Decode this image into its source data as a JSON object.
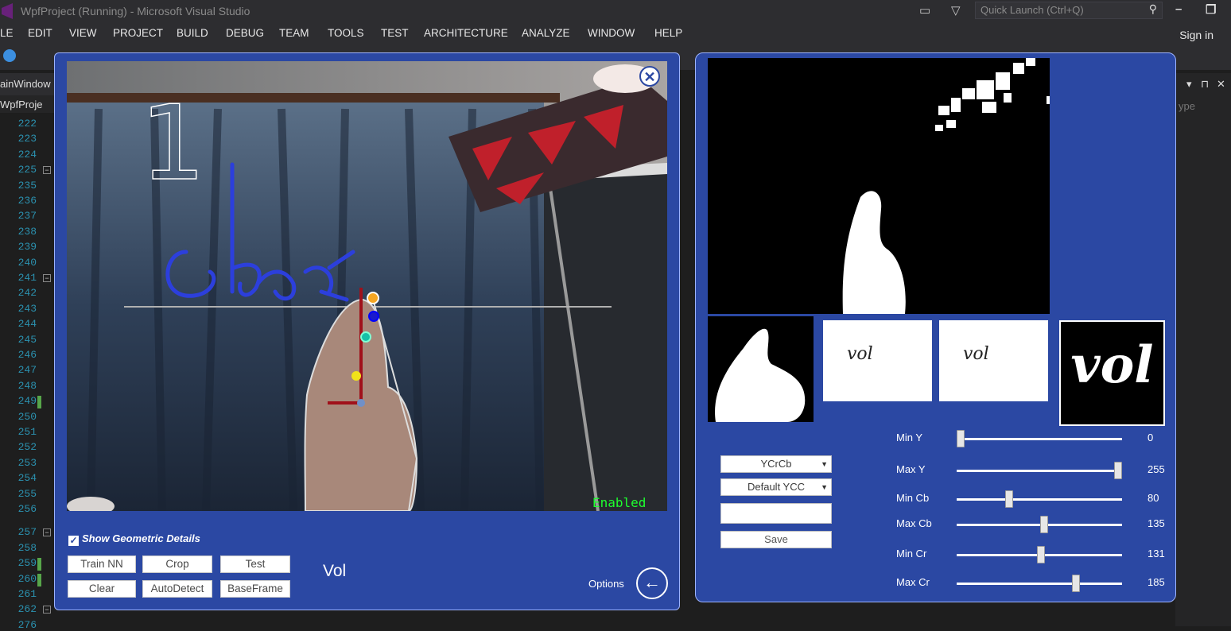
{
  "vs": {
    "title": "WpfProject (Running) - Microsoft Visual Studio",
    "quick_launch": "Quick Launch (Ctrl+Q)",
    "sign_in": "Sign in",
    "menu": [
      "LE",
      "EDIT",
      "VIEW",
      "PROJECT",
      "BUILD",
      "DEBUG",
      "TEAM",
      "TOOLS",
      "TEST",
      "ARCHITECTURE",
      "ANALYZE",
      "WINDOW",
      "HELP"
    ],
    "tab_main": "ainWindow",
    "tab_project": "WpfProje",
    "right_pane_text": "ype",
    "line_numbers": [
      "222",
      "223",
      "224",
      "225",
      "235",
      "236",
      "237",
      "238",
      "239",
      "240",
      "241",
      "242",
      "243",
      "244",
      "245",
      "246",
      "247",
      "248",
      "249",
      "250",
      "251",
      "252",
      "253",
      "254",
      "255",
      "256",
      "257",
      "258",
      "259",
      "260",
      "261",
      "262",
      "276"
    ]
  },
  "left": {
    "overlay_digit": "1",
    "status": "Enabled",
    "show_geometric_label": "Show Geometric Details",
    "show_geometric_checked": true,
    "buttons": {
      "train_nn": "Train NN",
      "crop": "Crop",
      "test": "Test",
      "clear": "Clear",
      "autodetect": "AutoDetect",
      "baseframe": "BaseFrame"
    },
    "result": "Vol",
    "options_label": "Options",
    "close_symbol": "✕",
    "back_symbol": "←"
  },
  "right": {
    "color_space": "YCrCb",
    "preset": "Default YCC",
    "name_value": "",
    "save_label": "Save",
    "thumb_text_1": "vol",
    "thumb_text_2": "vol",
    "thumb_text_3": "vol",
    "sliders": [
      {
        "label": "Min Y",
        "value": "0",
        "fraction": 0.0
      },
      {
        "label": "Max Y",
        "value": "255",
        "fraction": 1.0
      },
      {
        "label": "Min Cb",
        "value": "80",
        "fraction": 0.31
      },
      {
        "label": "Max Cb",
        "value": "135",
        "fraction": 0.53
      },
      {
        "label": "Min Cr",
        "value": "131",
        "fraction": 0.51
      },
      {
        "label": "Max Cr",
        "value": "185",
        "fraction": 0.73
      }
    ]
  },
  "colors": {
    "panel_blue": "#2b48a3",
    "enabled_green": "#1eff2f",
    "ink_blue": "#2c3fdc"
  }
}
